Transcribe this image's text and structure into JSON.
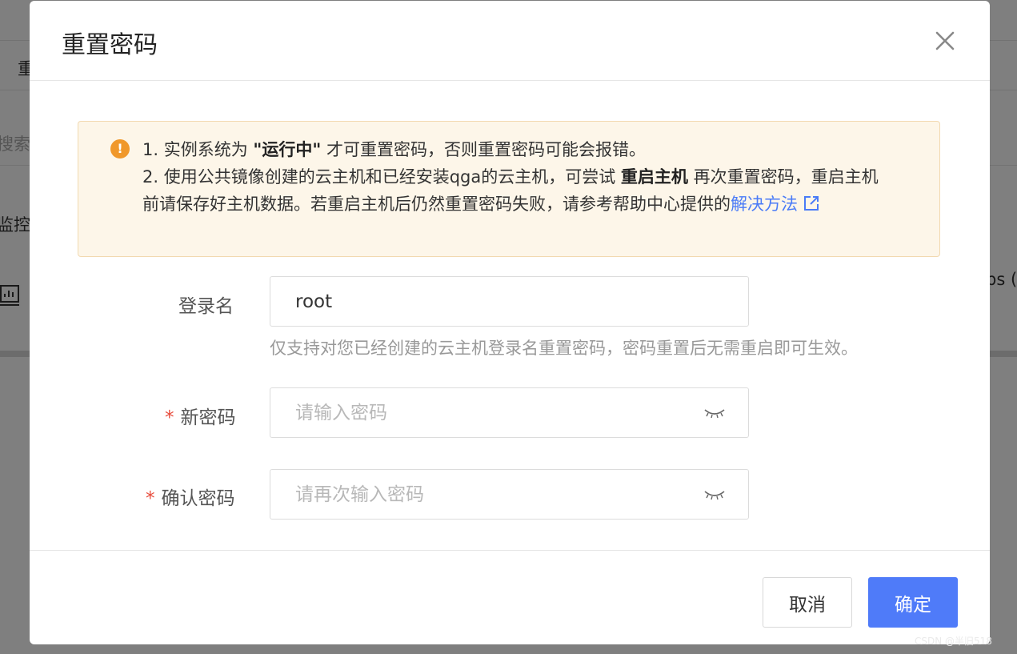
{
  "background": {
    "fragment_1": "重",
    "fragment_2": "搜索",
    "fragment_3": "监控",
    "fragment_4": "ps ("
  },
  "dialog": {
    "title": "重置密码",
    "close_icon": "close-icon",
    "alert": {
      "icon": "exclamation-icon",
      "line1_prefix": "1. 实例系统为 ",
      "line1_bold": "\"运行中\"",
      "line1_suffix": " 才可重置密码，否则重置密码可能会报错。",
      "line2_prefix": "2. 使用公共镜像创建的云主机和已经安装qga的云主机，可尝试 ",
      "line2_bold": "重启主机",
      "line2_suffix": " 再次重置密码，重启主机前请保存好主机数据。若重启主机后仍然重置密码失败，请参考帮助中心提供的",
      "link_text": "解决方法",
      "link_icon": "external-link-icon"
    },
    "form": {
      "login_label": "登录名",
      "login_value": "root",
      "login_hint": "仅支持对您已经创建的云主机登录名重置密码，密码重置后无需重启即可生效。",
      "new_password_label": "新密码",
      "new_password_placeholder": "请输入密码",
      "confirm_password_label": "确认密码",
      "confirm_password_placeholder": "请再次输入密码",
      "required_mark": "*",
      "eye_icon": "eye-closed-icon"
    },
    "footer": {
      "cancel_label": "取消",
      "ok_label": "确定"
    }
  },
  "watermark": "CSDN @半旧518",
  "colors": {
    "primary": "#4f7bf9",
    "warning_icon": "#f0982b",
    "alert_bg": "#fdf6e9",
    "alert_border": "#f2d9b0",
    "link": "#4a7bf7",
    "required": "#e74c3c"
  }
}
